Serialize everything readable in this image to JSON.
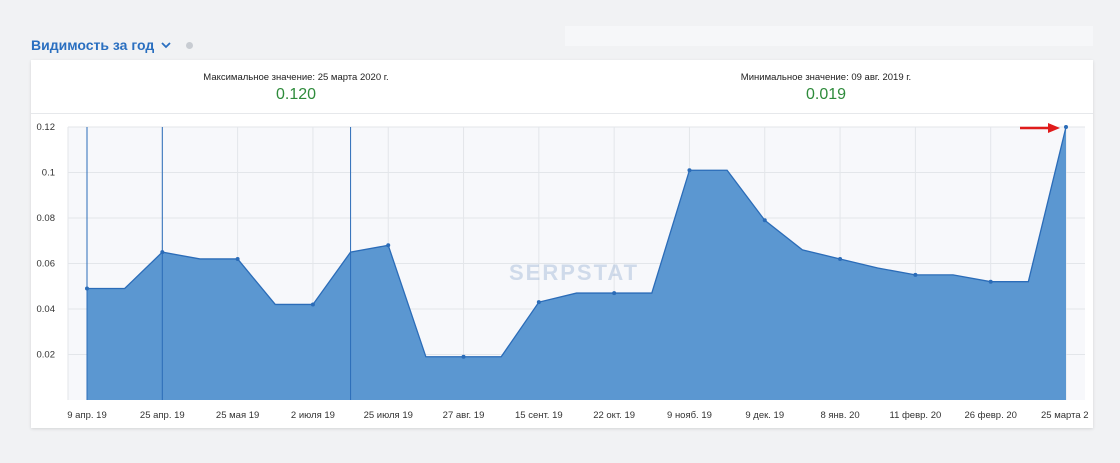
{
  "header": {
    "title": "Видимость за год"
  },
  "summary": {
    "max_label": "Максимальное значение: 25 марта 2020 г.",
    "max_value": "0.120",
    "min_label": "Минимальное значение: 09 авг. 2019 г.",
    "min_value": "0.019"
  },
  "watermark": "SERPSTAT",
  "colors": {
    "area": "#5b97d1",
    "line": "#2b6cb8",
    "value_green": "#2e8b3b",
    "arrow": "#e01b1b"
  },
  "chart_data": {
    "type": "area",
    "y_ticks": [
      "0.02",
      "0.04",
      "0.06",
      "0.08",
      "0.1",
      "0.12"
    ],
    "ylim": [
      0,
      0.12
    ],
    "x_tick_labels": [
      "9 апр. 19",
      "25 апр. 19",
      "25 мая 19",
      "2 июля 19",
      "25 июля 19",
      "27 авг. 19",
      "15 сент. 19",
      "22 окт. 19",
      "9 нояб. 19",
      "9 дек. 19",
      "8 янв. 20",
      "11 февр. 20",
      "26 февр. 20",
      "25 марта 2"
    ],
    "x_tick_positions": [
      0,
      2,
      4,
      6,
      8,
      10,
      12,
      14,
      16,
      18,
      20,
      22,
      24,
      26
    ],
    "points_x": [
      0,
      1,
      2,
      3,
      4,
      5,
      6,
      7,
      8,
      9,
      10,
      11,
      12,
      13,
      14,
      15,
      16,
      17,
      18,
      19,
      20,
      21,
      22,
      23,
      24,
      25,
      26
    ],
    "values": [
      0.049,
      0.049,
      0.065,
      0.062,
      0.062,
      0.042,
      0.042,
      0.065,
      0.068,
      0.019,
      0.019,
      0.019,
      0.043,
      0.047,
      0.047,
      0.047,
      0.101,
      0.101,
      0.079,
      0.066,
      0.062,
      0.058,
      0.055,
      0.055,
      0.052,
      0.052,
      0.12
    ],
    "marker_indices": [
      0,
      2,
      4,
      6,
      8,
      10,
      12,
      14,
      16,
      18,
      20,
      22,
      24,
      26
    ],
    "vertical_lines_at": [
      0,
      2,
      7
    ],
    "grid": true,
    "annotation": {
      "type": "arrow",
      "points_to_index": 26
    }
  }
}
